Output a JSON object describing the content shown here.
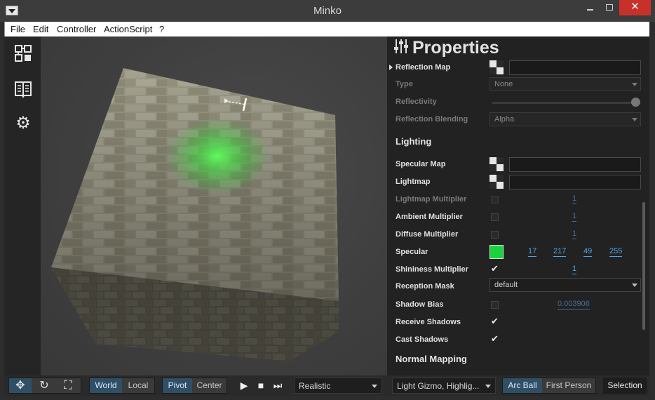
{
  "window": {
    "title": "Minko"
  },
  "menubar": [
    "File",
    "Edit",
    "Controller",
    "ActionScript",
    "?"
  ],
  "left_tools": [
    "scene-graph-icon",
    "library-book-icon",
    "gear-icon"
  ],
  "properties": {
    "title": "Properties",
    "reflection_map_label": "Reflection Map",
    "type_label": "Type",
    "type_value": "None",
    "reflectivity_label": "Reflectivity",
    "reflection_blending_label": "Reflection Blending",
    "reflection_blending_value": "Alpha",
    "lighting_section": "Lighting",
    "specular_map_label": "Specular Map",
    "lightmap_label": "Lightmap",
    "lightmap_multiplier_label": "Lightmap Multiplier",
    "lightmap_multiplier_value": "1",
    "ambient_multiplier_label": "Ambient Multiplier",
    "ambient_multiplier_value": "1",
    "diffuse_multiplier_label": "Diffuse Multiplier",
    "diffuse_multiplier_value": "1",
    "specular_label": "Specular",
    "specular_color": "#19d43f",
    "specular_r": "17",
    "specular_g": "217",
    "specular_b": "49",
    "specular_a": "255",
    "shininess_multiplier_label": "Shininess Multiplier",
    "shininess_multiplier_value": "1",
    "reception_mask_label": "Reception Mask",
    "reception_mask_value": "default",
    "shadow_bias_label": "Shadow Bias",
    "shadow_bias_value": "0.003906",
    "receive_shadows_label": "Receive Shadows",
    "cast_shadows_label": "Cast Shadows",
    "normal_mapping_section": "Normal Mapping"
  },
  "bottombar": {
    "space_world": "World",
    "space_local": "Local",
    "pivot": "Pivot",
    "center": "Center",
    "render_mode": "Realistic",
    "overlays": "Light Gizmo, Highlig...",
    "arc_ball": "Arc Ball",
    "first_person": "First Person",
    "selection": "Selection"
  },
  "colors": {
    "accent": "#2f4f66",
    "link": "#4fa3e6",
    "close_button": "#c7312a"
  }
}
